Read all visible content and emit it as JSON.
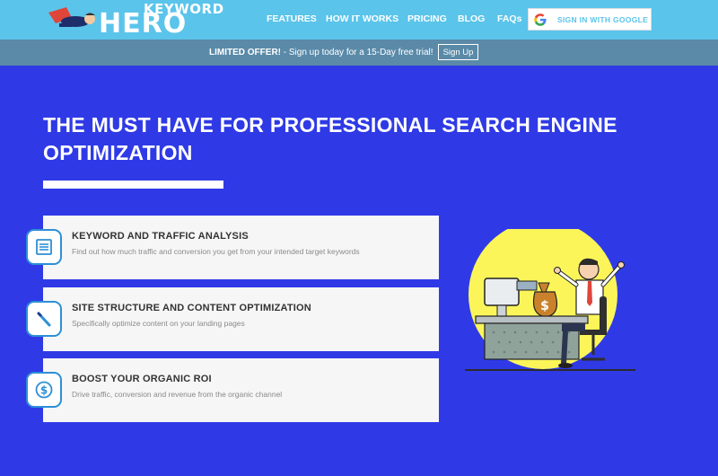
{
  "brand": {
    "name_line1": "KEYWORD",
    "name_line2": "HERO"
  },
  "nav": {
    "items": [
      "FEATURES",
      "HOW IT WORKS",
      "PRICING",
      "BLOG",
      "FAQs"
    ],
    "google_button_label": "SIGN IN WITH GOOGLE"
  },
  "promo": {
    "bold": "LIMITED OFFER!",
    "text": " - Sign up today for a 15-Day free trial!",
    "button_label": "Sign Up"
  },
  "hero": {
    "headline": "THE MUST HAVE FOR PROFESSIONAL SEARCH ENGINE OPTIMIZATION"
  },
  "features": [
    {
      "icon": "document-icon",
      "title": "KEYWORD AND TRAFFIC ANALYSIS",
      "description": "Find out how much traffic and conversion you get from your intended target keywords"
    },
    {
      "icon": "pencil-icon",
      "title": "SITE STRUCTURE AND CONTENT OPTIMIZATION",
      "description": "Specifically optimize content on your landing pages"
    },
    {
      "icon": "dollar-icon",
      "title": "BOOST YOUR ORGANIC ROI",
      "description": "Drive traffic, conversion and revenue from the organic channel"
    }
  ],
  "illustration": {
    "money_bag_symbol": "$"
  },
  "colors": {
    "header_bg": "#5bc4ea",
    "promo_bg": "#5a8aa8",
    "page_bg": "#2f3ae6",
    "card_bg": "#f6f6f6",
    "icon_border": "#2d8fd6",
    "illustration_sun": "#fbf55a"
  }
}
